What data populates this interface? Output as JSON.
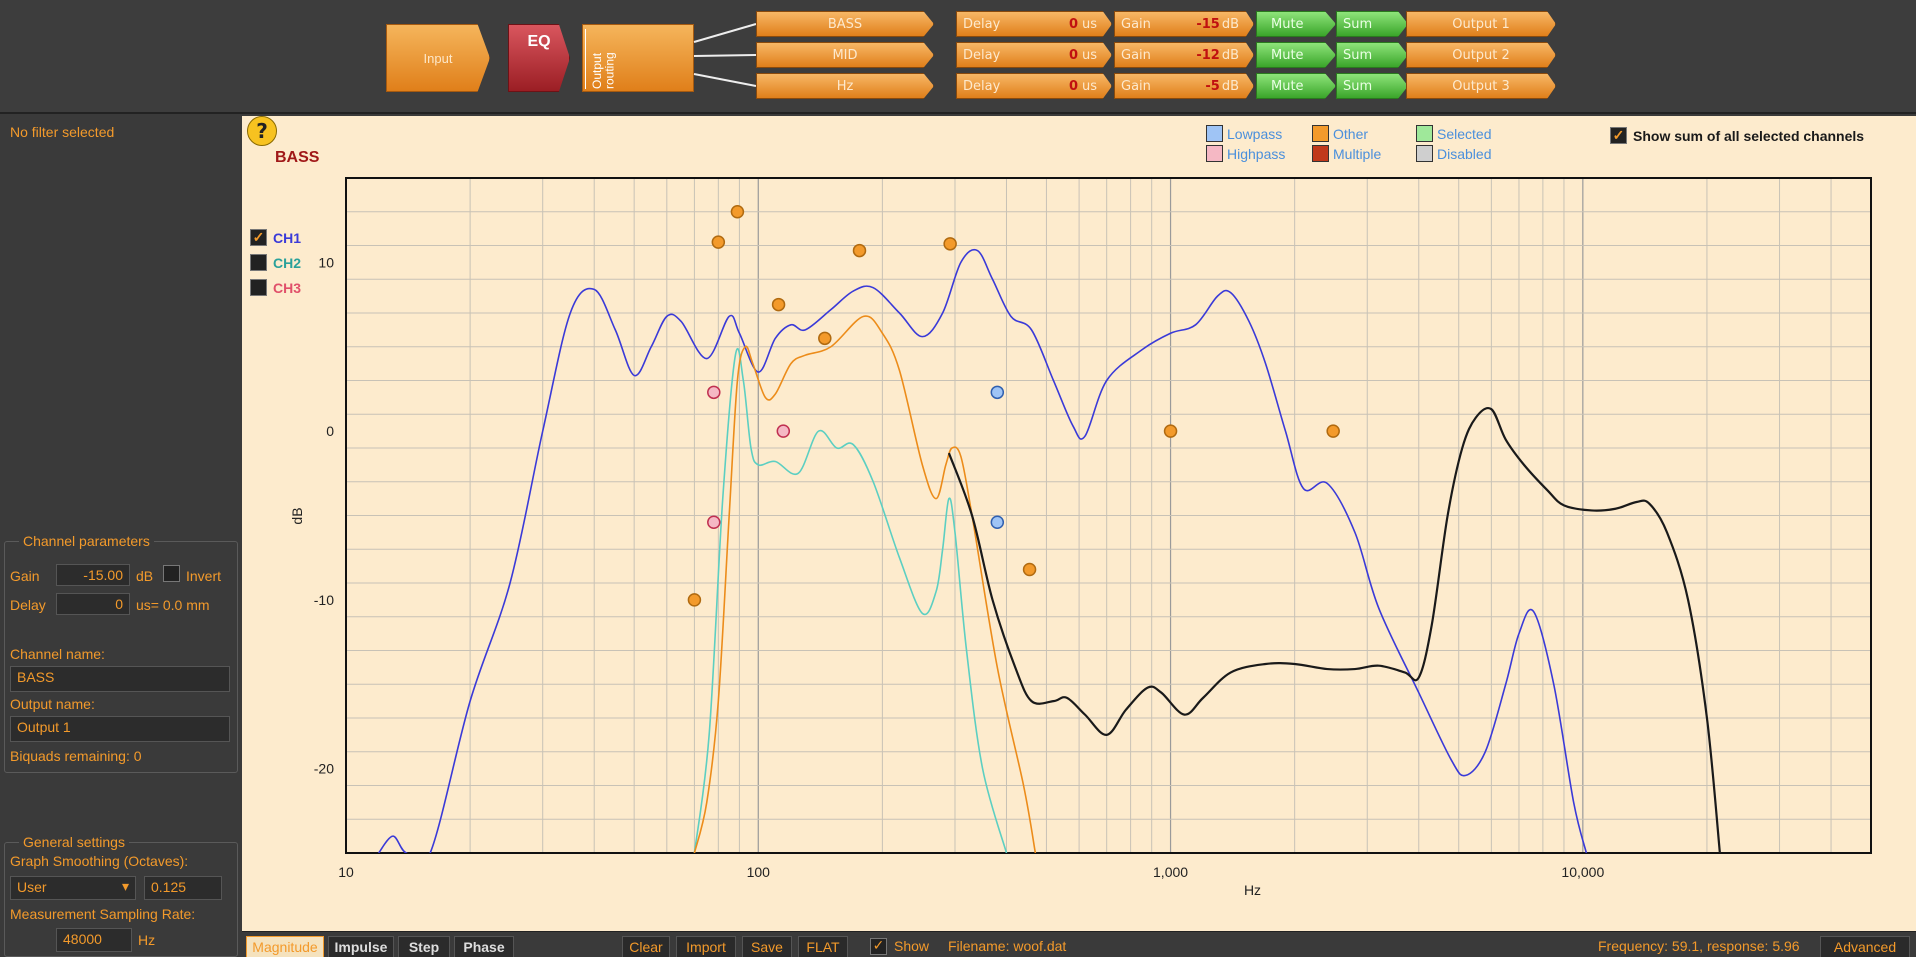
{
  "routing": {
    "input_label": "Input",
    "eq_label": "EQ",
    "output_routing_label": "Output routing",
    "channels": [
      {
        "name": "BASS",
        "delay_label": "Delay",
        "delay_value": "0",
        "delay_unit": "us",
        "gain_label": "Gain",
        "gain_value": "-15",
        "gain_unit": "dB",
        "mute_label": "Mute",
        "sum_label": "Sum",
        "output_label": "Output 1"
      },
      {
        "name": "MID",
        "delay_label": "Delay",
        "delay_value": "0",
        "delay_unit": "us",
        "gain_label": "Gain",
        "gain_value": "-12",
        "gain_unit": "dB",
        "mute_label": "Mute",
        "sum_label": "Sum",
        "output_label": "Output 2"
      },
      {
        "name": "Hz",
        "delay_label": "Delay",
        "delay_value": "0",
        "delay_unit": "us",
        "gain_label": "Gain",
        "gain_value": "-5",
        "gain_unit": "dB",
        "mute_label": "Mute",
        "sum_label": "Sum",
        "output_label": "Output 3"
      }
    ]
  },
  "left": {
    "no_filter": "No filter selected",
    "channel_params_title": "Channel parameters",
    "gain_label": "Gain",
    "gain_value": "-15.00",
    "gain_unit": "dB",
    "invert_label": "Invert",
    "delay_label": "Delay",
    "delay_value": "0",
    "delay_unit": "us= 0.0 mm",
    "channel_name_label": "Channel name:",
    "channel_name_value": "BASS",
    "output_name_label": "Output name:",
    "output_name_value": "Output 1",
    "biquads": "Biquads remaining: 0",
    "general_title": "General settings",
    "smoothing_label": "Graph Smoothing (Octaves):",
    "smoothing_select": "User",
    "smoothing_value": "0.125",
    "sampling_label": "Measurement Sampling Rate:",
    "sampling_value": "48000",
    "sampling_unit": "Hz"
  },
  "graph": {
    "help": "?",
    "title": "BASS",
    "show_sum_label": "Show sum of all selected channels",
    "show_sum_checked": true,
    "legend": [
      {
        "label": "Lowpass",
        "color": "#9fc4f5",
        "text_color": "#4a8fdc"
      },
      {
        "label": "Highpass",
        "color": "#f5b8c4",
        "text_color": "#4a8fdc"
      },
      {
        "label": "Other",
        "color": "#f39a2b",
        "text_color": "#4a8fdc"
      },
      {
        "label": "Multiple",
        "color": "#c0391b",
        "text_color": "#4a8fdc"
      },
      {
        "label": "Selected",
        "color": "#9fe89a",
        "text_color": "#4a8fdc"
      },
      {
        "label": "Disabled",
        "color": "#cfcfcf",
        "text_color": "#4a8fdc"
      }
    ],
    "channels": [
      {
        "label": "CH1",
        "checked": true,
        "color": "#3a3ad8"
      },
      {
        "label": "CH2",
        "checked": false,
        "color": "#2aa19a"
      },
      {
        "label": "CH3",
        "checked": false,
        "color": "#e0506a"
      }
    ]
  },
  "chart_data": {
    "type": "line",
    "xlabel": "Hz",
    "ylabel": "dB",
    "xscale": "log",
    "xlim": [
      10,
      50000
    ],
    "ylim": [
      -25,
      15
    ],
    "xticks": [
      10,
      100,
      1000,
      10000
    ],
    "xtick_labels": [
      "10",
      "100",
      "1,000",
      "10,000"
    ],
    "yticks": [
      -20,
      -10,
      0,
      10
    ],
    "ytick_labels": [
      "-20",
      "-10",
      "0",
      "10"
    ],
    "grid": true,
    "series": [
      {
        "color": "#3a3ad8",
        "points": [
          [
            12,
            -25
          ],
          [
            13,
            -24
          ],
          [
            14,
            -25
          ],
          [
            16,
            -25
          ],
          [
            20,
            -16
          ],
          [
            25,
            -9
          ],
          [
            30,
            0
          ],
          [
            35,
            7
          ],
          [
            40,
            8.4
          ],
          [
            45,
            6
          ],
          [
            50,
            3.3
          ],
          [
            55,
            5
          ],
          [
            60,
            6.8
          ],
          [
            65,
            6.5
          ],
          [
            75,
            4.3
          ],
          [
            85,
            6.8
          ],
          [
            90,
            5.8
          ],
          [
            100,
            3.5
          ],
          [
            110,
            5.5
          ],
          [
            120,
            6.3
          ],
          [
            130,
            6
          ],
          [
            150,
            7.2
          ],
          [
            170,
            8.3
          ],
          [
            190,
            8.5
          ],
          [
            220,
            7
          ],
          [
            250,
            5.6
          ],
          [
            280,
            7
          ],
          [
            310,
            10
          ],
          [
            340,
            10.7
          ],
          [
            370,
            9
          ],
          [
            410,
            6.8
          ],
          [
            460,
            6
          ],
          [
            520,
            3
          ],
          [
            580,
            0.3
          ],
          [
            620,
            -0.3
          ],
          [
            700,
            3
          ],
          [
            850,
            4.8
          ],
          [
            1000,
            5.8
          ],
          [
            1150,
            6.3
          ],
          [
            1300,
            8
          ],
          [
            1400,
            8.2
          ],
          [
            1550,
            6.5
          ],
          [
            1700,
            4
          ],
          [
            1900,
            0
          ],
          [
            2100,
            -3.4
          ],
          [
            2400,
            -3.1
          ],
          [
            2800,
            -6
          ],
          [
            3200,
            -10.5
          ],
          [
            4000,
            -15.5
          ],
          [
            4800,
            -19.5
          ],
          [
            5200,
            -20.4
          ],
          [
            5800,
            -19
          ],
          [
            6500,
            -15
          ],
          [
            7000,
            -12
          ],
          [
            7600,
            -10.7
          ],
          [
            8500,
            -15
          ],
          [
            9500,
            -22
          ],
          [
            10200,
            -25
          ]
        ]
      },
      {
        "color": "#5ccfc2",
        "points": [
          [
            70,
            -25
          ],
          [
            76,
            -18
          ],
          [
            82,
            -4
          ],
          [
            88,
            4.5
          ],
          [
            92,
            3
          ],
          [
            96,
            -1
          ],
          [
            100,
            -2
          ],
          [
            110,
            -1.8
          ],
          [
            125,
            -2.5
          ],
          [
            140,
            0
          ],
          [
            155,
            -1
          ],
          [
            170,
            -0.8
          ],
          [
            190,
            -3
          ],
          [
            220,
            -7.5
          ],
          [
            250,
            -10.8
          ],
          [
            270,
            -9.5
          ],
          [
            280,
            -7
          ],
          [
            290,
            -4
          ],
          [
            300,
            -6
          ],
          [
            320,
            -13
          ],
          [
            350,
            -20
          ],
          [
            400,
            -25
          ]
        ]
      },
      {
        "color": "#ec8c1a",
        "points": [
          [
            70,
            -25
          ],
          [
            75,
            -22
          ],
          [
            80,
            -16
          ],
          [
            85,
            -5
          ],
          [
            89,
            3
          ],
          [
            93,
            5
          ],
          [
            97,
            4
          ],
          [
            104,
            2
          ],
          [
            110,
            2.2
          ],
          [
            120,
            4
          ],
          [
            130,
            4.5
          ],
          [
            150,
            5
          ],
          [
            180,
            6.8
          ],
          [
            200,
            5.8
          ],
          [
            220,
            3.6
          ],
          [
            250,
            -2
          ],
          [
            270,
            -4
          ],
          [
            285,
            -2
          ],
          [
            295,
            -1
          ],
          [
            310,
            -1.5
          ],
          [
            330,
            -5
          ],
          [
            380,
            -14
          ],
          [
            440,
            -21
          ],
          [
            470,
            -25
          ]
        ]
      },
      {
        "color": "#1a1a1a",
        "points": [
          [
            290,
            -1.3
          ],
          [
            330,
            -5
          ],
          [
            370,
            -10
          ],
          [
            420,
            -14
          ],
          [
            460,
            -16
          ],
          [
            520,
            -16
          ],
          [
            560,
            -15.8
          ],
          [
            620,
            -16.8
          ],
          [
            700,
            -18
          ],
          [
            780,
            -16.5
          ],
          [
            880,
            -15.2
          ],
          [
            950,
            -15.5
          ],
          [
            1080,
            -16.8
          ],
          [
            1200,
            -15.8
          ],
          [
            1400,
            -14.3
          ],
          [
            1700,
            -13.8
          ],
          [
            2000,
            -13.8
          ],
          [
            2400,
            -14.1
          ],
          [
            2800,
            -14.1
          ],
          [
            3200,
            -13.9
          ],
          [
            3700,
            -14.3
          ],
          [
            4000,
            -14.6
          ],
          [
            4300,
            -11.5
          ],
          [
            4700,
            -5
          ],
          [
            5100,
            -1
          ],
          [
            5500,
            0.8
          ],
          [
            6000,
            1.3
          ],
          [
            6500,
            -0.5
          ],
          [
            7200,
            -2
          ],
          [
            8200,
            -3.5
          ],
          [
            9000,
            -4.4
          ],
          [
            10500,
            -4.7
          ],
          [
            12000,
            -4.6
          ],
          [
            13500,
            -4.2
          ],
          [
            14500,
            -4.3
          ],
          [
            16000,
            -6
          ],
          [
            18000,
            -10
          ],
          [
            20000,
            -17
          ],
          [
            21500,
            -25
          ]
        ]
      }
    ],
    "filter_markers": [
      {
        "kind": "Other",
        "freq": 80,
        "db": 11.2
      },
      {
        "kind": "Other",
        "freq": 89,
        "db": 13
      },
      {
        "kind": "Other",
        "freq": 112,
        "db": 7.5
      },
      {
        "kind": "Other",
        "freq": 145,
        "db": 5.5
      },
      {
        "kind": "Other",
        "freq": 176,
        "db": 10.7
      },
      {
        "kind": "Other",
        "freq": 292,
        "db": 11.1
      },
      {
        "kind": "Other",
        "freq": 70,
        "db": -10
      },
      {
        "kind": "Other",
        "freq": 455,
        "db": -8.2
      },
      {
        "kind": "Other",
        "freq": 1000,
        "db": 0
      },
      {
        "kind": "Other",
        "freq": 2480,
        "db": 0
      },
      {
        "kind": "Highpass",
        "freq": 78,
        "db": 2.3
      },
      {
        "kind": "Highpass",
        "freq": 78,
        "db": -5.4
      },
      {
        "kind": "Highpass",
        "freq": 115,
        "db": 0
      },
      {
        "kind": "Lowpass",
        "freq": 380,
        "db": 2.3
      },
      {
        "kind": "Lowpass",
        "freq": 380,
        "db": -5.4
      }
    ]
  },
  "bottom": {
    "tabs": [
      "Magnitude",
      "Impulse",
      "Step",
      "Phase"
    ],
    "active_tab": "Magnitude",
    "clear_label": "Clear",
    "import_label": "Import",
    "save_label": "Save",
    "flat_label": "FLAT",
    "show_label": "Show",
    "filename": "Filename: woof.dat",
    "status": "Frequency: 59.1, response: 5.96",
    "advanced_label": "Advanced"
  }
}
